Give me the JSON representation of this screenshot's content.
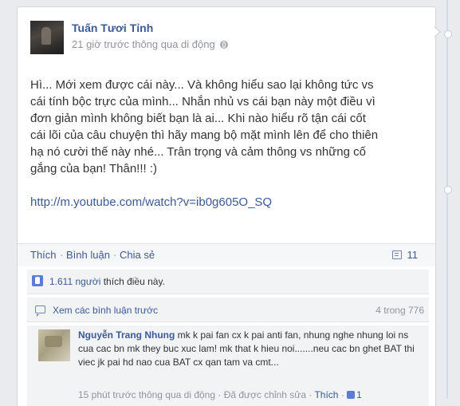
{
  "post": {
    "author": "Tuấn Tươi Tỉnh",
    "meta": "21 giờ trước thông qua di động",
    "body_lines": [
      "Hì... Mới xem được cái này... Và không hiểu sao lại không tức vs",
      "cái tính bộc trực của mình... Nhắn nhủ vs cái bạn này một điều vì",
      "đơn giản mình không biết bạn là ai... Khi nào hiểu rõ tận cái cốt",
      "cái lõi của câu chuyện thì hãy mang bộ mặt mình lên để cho thiên",
      "hạ nó cười thế này nhé... Trân trọng và cảm thông vs những cố",
      "gắng của bạn! Thân!!! :)"
    ],
    "link": "http://m.youtube.com/watch?v=ib0g605O_SQ"
  },
  "actions": {
    "like": "Thích",
    "comment": "Bình luận",
    "share": "Chia sẻ",
    "separator": "·",
    "comment_count": "11"
  },
  "likes": {
    "count": "1.611 người",
    "suffix": " thích điều này."
  },
  "previous_comments": {
    "label": "Xem các bình luận trước",
    "count": "4 trong 776"
  },
  "comment": {
    "author": "Nguyễn Trang Nhung",
    "text": " mk k pai fan cx k pai anti fan, nhung nghe nhung loi ns cua cac bn mk they buc xuc lam! mk that k hieu noi.......neu cac bn ghet BAT thi viec jk pai hd nao cua BAT cx qan tam va cmt...",
    "time": "15 phút trước thông qua di động",
    "edited": "Đã được chỉnh sửa",
    "like": "Thích",
    "like_count": "1",
    "separator": " · "
  },
  "colors": {
    "link_blue": "#3b5998",
    "meta_gray": "#90949c",
    "ufi_bg": "#f2f3f5"
  }
}
